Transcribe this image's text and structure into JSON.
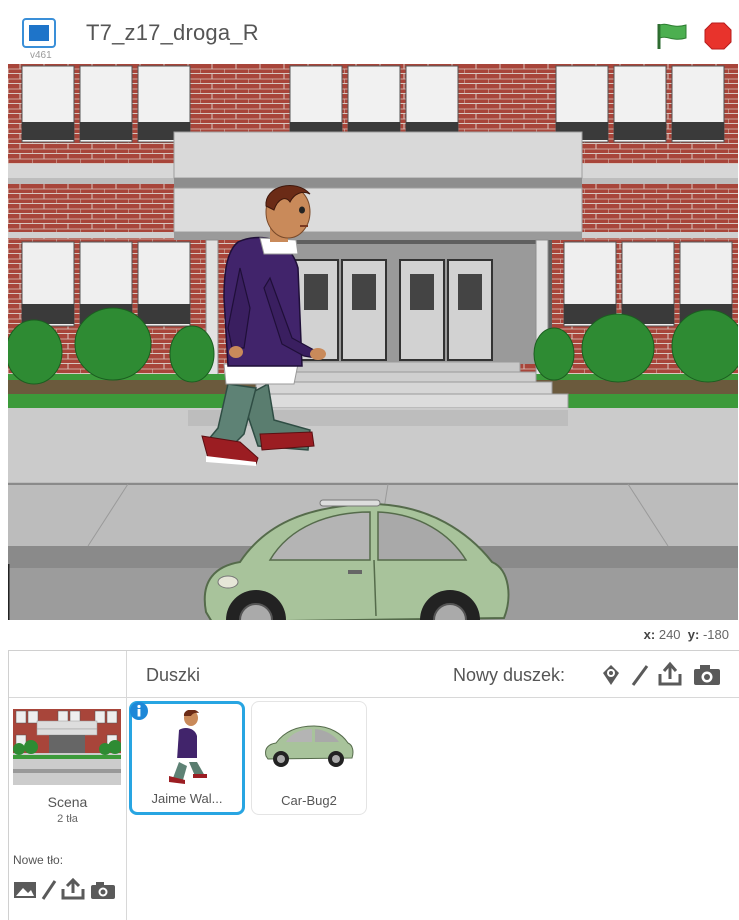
{
  "header": {
    "version": "v461",
    "project_title": "T7_z17_droga_R"
  },
  "stage": {
    "mouse_x_label": "x:",
    "mouse_x": "240",
    "mouse_y_label": "y:",
    "mouse_y": "-180"
  },
  "sprites_pane": {
    "title": "Duszki",
    "new_sprite_label": "Nowy duszek:",
    "sprites": [
      {
        "name": "Jaime Wal...",
        "selected": true
      },
      {
        "name": "Car-Bug2",
        "selected": false
      }
    ]
  },
  "scene": {
    "label": "Scena",
    "backdrop_count": "2 tła",
    "new_backdrop_label": "Nowe tło:"
  },
  "colors": {
    "accent_blue": "#28a5e2",
    "flag_green": "#4caf50",
    "stop_red": "#e8332c"
  },
  "icons": [
    "fullscreen-icon",
    "green-flag-icon",
    "stop-icon",
    "sprite-library-icon",
    "paint-icon",
    "upload-icon",
    "camera-icon",
    "info-icon",
    "image-library-icon"
  ]
}
